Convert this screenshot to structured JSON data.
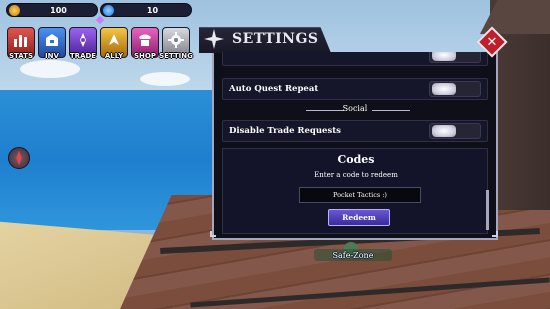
{
  "hud": {
    "gold_value": "100",
    "gems_value": "10",
    "gold_icon": "coin-icon",
    "gems_icon": "gem-icon"
  },
  "menu": [
    {
      "label": "STATS",
      "icon": "stats-bars-icon",
      "color": "#c8332e"
    },
    {
      "label": "INV",
      "icon": "inventory-icon",
      "color": "#2f6fd6"
    },
    {
      "label": "TRADE",
      "icon": "trade-icon",
      "color": "#7b3fd0"
    },
    {
      "label": "ALLY",
      "icon": "ally-icon",
      "color": "#e2a21a"
    },
    {
      "label": "SHOP",
      "icon": "shop-icon",
      "color": "#c83a9c"
    },
    {
      "label": "SETTING",
      "icon": "gear-icon",
      "color": "#b9b9c4"
    }
  ],
  "settings": {
    "title": "SETTINGS",
    "rows": [
      {
        "label": "Auto Quest Repeat",
        "toggle": "on"
      },
      {
        "label": "Disable Trade Requests",
        "toggle": "on"
      }
    ],
    "section_social": "Social",
    "codes_title": "Codes",
    "codes_subtitle": "Enter a code to redeem",
    "code_input_value": "Pocket Tactics :)",
    "redeem_label": "Redeem"
  },
  "zone_label": "Safe-Zone",
  "colors": {
    "window_bg": "#0f0f1a",
    "close_red": "#c01e2a",
    "redeem_purple": "#5b48c8"
  }
}
